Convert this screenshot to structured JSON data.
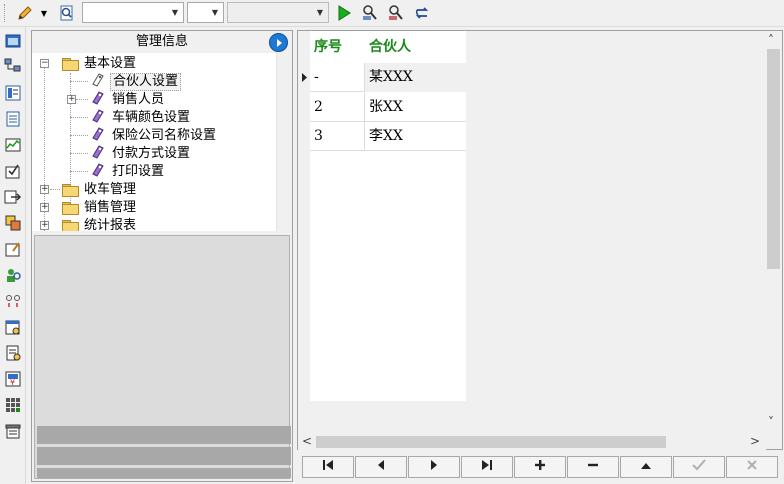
{
  "toolbar": {
    "combo1_value": "",
    "combo2_value": "",
    "combo3_value": ""
  },
  "panel": {
    "title": "管理信息",
    "tree": {
      "basic": "基本设置",
      "partner": "合伙人设置",
      "sales_staff": "销售人员",
      "vehicle_color": "车辆颜色设置",
      "insurer": "保险公司名称设置",
      "payment": "付款方式设置",
      "print": "打印设置",
      "receiving": "收车管理",
      "sales_mgmt": "销售管理",
      "reports": "统计报表"
    }
  },
  "grid": {
    "columns": [
      "序号",
      "合伙人"
    ],
    "rows": [
      {
        "no": "-",
        "name": "某XXX"
      },
      {
        "no": "2",
        "name": "张XX"
      },
      {
        "no": "3",
        "name": "李XX"
      }
    ],
    "header_color": "#1a8a1a"
  },
  "icons": {
    "toolbar": [
      "pencil-icon",
      "search-doc-icon",
      "play-icon",
      "zoom-user-icon",
      "zoom-user2-icon",
      "refresh-icon"
    ],
    "nav": [
      "first-icon",
      "prev-icon",
      "next-icon",
      "last-icon",
      "add-icon",
      "remove-icon",
      "up-icon",
      "confirm-icon",
      "cancel-icon"
    ]
  }
}
